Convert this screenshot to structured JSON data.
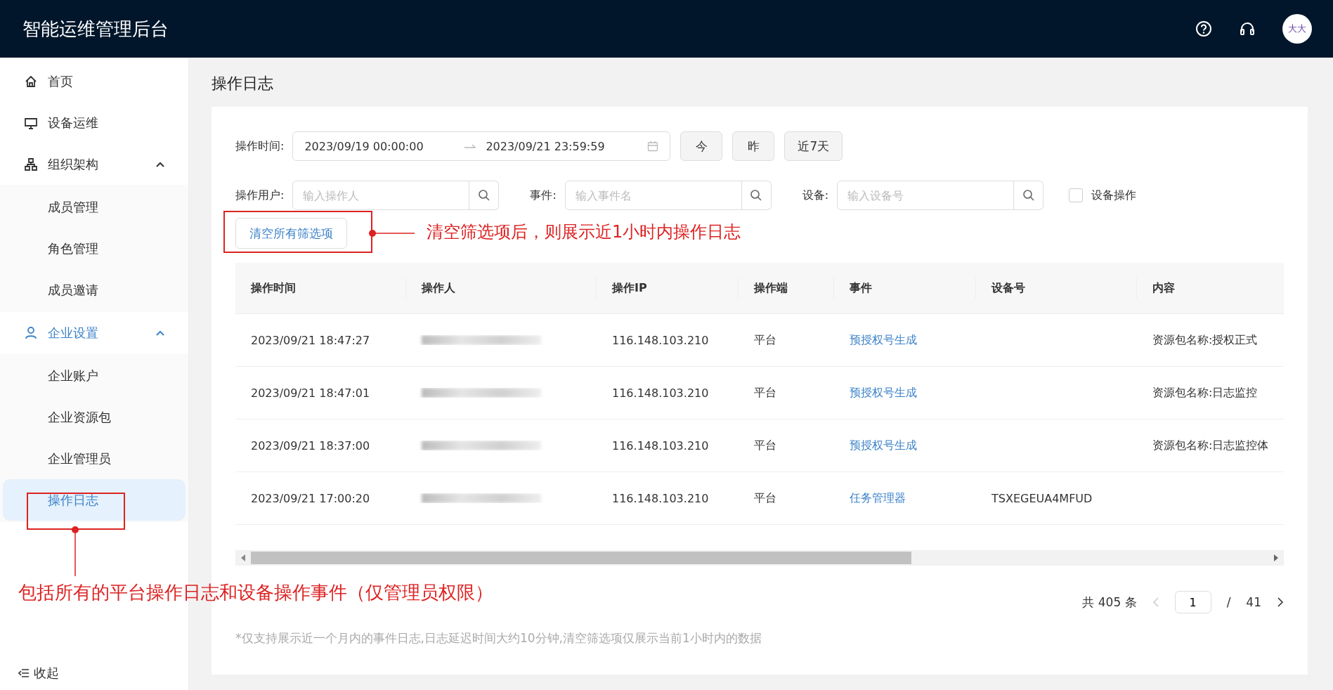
{
  "header": {
    "title": "智能运维管理后台",
    "avatar_text": "大大"
  },
  "sidebar": {
    "items": [
      {
        "label": "首页",
        "kind": "home",
        "active": false
      },
      {
        "label": "设备运维",
        "kind": "monitor",
        "active": false
      },
      {
        "label": "组织架构",
        "kind": "org",
        "expanded": true,
        "active": false,
        "children": [
          {
            "label": "成员管理",
            "selected": false
          },
          {
            "label": "角色管理",
            "selected": false
          },
          {
            "label": "成员邀请",
            "selected": false
          }
        ]
      },
      {
        "label": "企业设置",
        "kind": "user",
        "expanded": true,
        "active": true,
        "children": [
          {
            "label": "企业账户",
            "selected": false
          },
          {
            "label": "企业资源包",
            "selected": false
          },
          {
            "label": "企业管理员",
            "selected": false
          },
          {
            "label": "操作日志",
            "selected": true
          }
        ]
      }
    ],
    "collapse_label": "收起"
  },
  "page_title": "操作日志",
  "filters": {
    "time_label": "操作时间:",
    "date_start": "2023/09/19 00:00:00",
    "date_end": "2023/09/21 23:59:59",
    "quick_buttons": [
      "今",
      "昨",
      "近7天"
    ],
    "user": {
      "label": "操作用户:",
      "placeholder": "输入操作人"
    },
    "event": {
      "label": "事件:",
      "placeholder": "输入事件名"
    },
    "device": {
      "label": "设备:",
      "placeholder": "输入设备号"
    },
    "device_op": {
      "label": "设备操作",
      "checked": false
    },
    "clear_button": "清空所有筛选项"
  },
  "table": {
    "columns": [
      "操作时间",
      "操作人",
      "操作IP",
      "操作端",
      "事件",
      "设备号",
      "内容"
    ],
    "rows": [
      {
        "time": "2023/09/21 18:47:27",
        "ip": "116.148.103.210",
        "client": "平台",
        "event": "预授权号生成",
        "content": "资源包名称:授权正式"
      },
      {
        "time": "2023/09/21 18:47:01",
        "ip": "116.148.103.210",
        "client": "平台",
        "event": "预授权号生成",
        "content": "资源包名称:日志监控"
      },
      {
        "time": "2023/09/21 18:37:00",
        "ip": "116.148.103.210",
        "client": "平台",
        "event": "预授权号生成",
        "content": "资源包名称:日志监控体"
      },
      {
        "time": "2023/09/21 17:00:20",
        "ip": "116.148.103.210",
        "client": "平台",
        "event": "任务管理器",
        "device": "TSXEGEUA4MFUD"
      }
    ]
  },
  "pagination": {
    "total": "共 405 条",
    "page": "1",
    "separator": "/",
    "pages": "41"
  },
  "footnote": "*仅支持展示近一个月内的事件日志,日志延迟时间大约10分钟,清空筛选项仅展示当前1小时内的数据",
  "annotations": [
    "清空筛选项后，则展示近1小时内操作日志",
    "包括所有的平台操作日志和设备操作事件（仅管理员权限）"
  ]
}
